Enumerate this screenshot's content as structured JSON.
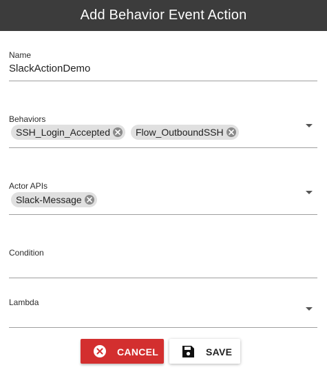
{
  "dialog": {
    "title": "Add Behavior Event Action"
  },
  "fields": {
    "name": {
      "label": "Name",
      "value": "SlackActionDemo"
    },
    "behaviors": {
      "label": "Behaviors",
      "chips": [
        "SSH_Login_Accepted",
        "Flow_OutboundSSH"
      ],
      "dropdown_icon": "arrow-drop-down"
    },
    "actor_apis": {
      "label": "Actor APIs",
      "chips": [
        "Slack-Message"
      ],
      "dropdown_icon": "arrow-drop-down"
    },
    "condition": {
      "label": "Condition",
      "value": ""
    },
    "lambda": {
      "label": "Lambda",
      "value": "",
      "dropdown_icon": "arrow-drop-down"
    }
  },
  "actions": {
    "cancel": {
      "label": "CANCEL",
      "icon": "cancel-circle-icon",
      "color": "#d32f2f"
    },
    "save": {
      "label": "SAVE",
      "icon": "floppy-disk-icon"
    }
  },
  "colors": {
    "titlebar": "#3c3c3c",
    "chip": "#e0e0e0",
    "cancel": "#d32f2f"
  }
}
